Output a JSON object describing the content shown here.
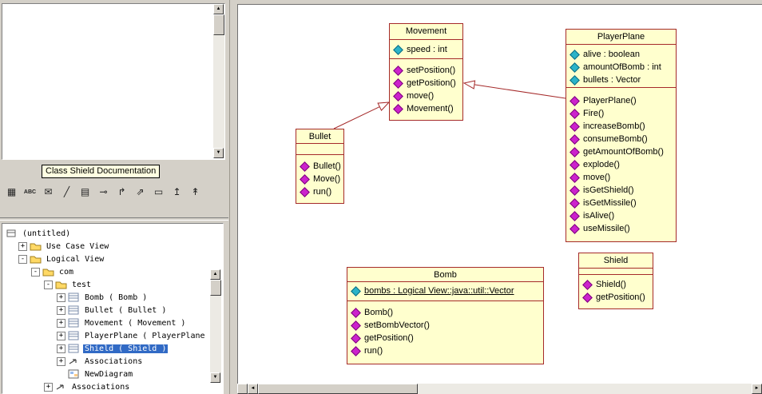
{
  "colors": {
    "chrome_bg": "#D4D0C8",
    "canvas_bg": "#FFFFFF",
    "class_fill": "#FFFFCE",
    "class_border": "#A52A2A",
    "selection": "#316AC5",
    "selection_text": "#FFFFFF",
    "tooltip_bg": "#FFFFE1",
    "attr_icon_color": "#2BB3C8",
    "method_icon_color": "#CC22CC"
  },
  "icons": {
    "up": "▲",
    "down": "▼",
    "left": "◄",
    "right": "►"
  },
  "tooltip": {
    "text": "Class Shield Documentation"
  },
  "toolbar": {
    "icons": [
      {
        "name": "grid-icon",
        "glyph": "▦"
      },
      {
        "name": "spellcheck-icon",
        "glyph": "ABC"
      },
      {
        "name": "note-icon",
        "glyph": "✉"
      },
      {
        "name": "pencil-icon",
        "glyph": "╱"
      },
      {
        "name": "document-icon",
        "glyph": "▤"
      },
      {
        "name": "anchor-note-icon",
        "glyph": "⊸"
      },
      {
        "name": "corner-arrow-icon",
        "glyph": "↱"
      },
      {
        "name": "diagonal-arrow-icon",
        "glyph": "⇗"
      },
      {
        "name": "container-icon",
        "glyph": "▭"
      },
      {
        "name": "up-arrow-icon",
        "glyph": "↥"
      },
      {
        "name": "promote-arrow-icon",
        "glyph": "↟"
      }
    ]
  },
  "tree": {
    "items": [
      {
        "label": "(untitled)",
        "icon": "model-icon",
        "level": 0
      },
      {
        "label": "Use Case View",
        "icon": "folder-icon",
        "level": 1,
        "expander": "plus"
      },
      {
        "label": "Logical View",
        "icon": "folder-icon",
        "level": 1,
        "expander": "minus"
      },
      {
        "label": "com",
        "icon": "folder-icon",
        "level": 2,
        "expander": "minus"
      },
      {
        "label": "test",
        "icon": "folder-icon",
        "level": 3,
        "expander": "minus"
      },
      {
        "label": "Bomb ( Bomb )",
        "icon": "class-icon",
        "level": 4,
        "expander": "plus"
      },
      {
        "label": "Bullet ( Bullet )",
        "icon": "class-icon",
        "level": 4,
        "expander": "plus"
      },
      {
        "label": "Movement ( Movement )",
        "icon": "class-icon",
        "level": 4,
        "expander": "plus"
      },
      {
        "label": "PlayerPlane ( PlayerPlane )",
        "icon": "class-icon",
        "level": 4,
        "expander": "plus"
      },
      {
        "label": "Shield ( Shield )",
        "icon": "class-icon",
        "level": 4,
        "expander": "plus",
        "selected": true
      },
      {
        "label": "Associations",
        "icon": "association-icon",
        "level": 4,
        "expander": "plus"
      },
      {
        "label": "NewDiagram",
        "icon": "diagram-icon",
        "level": 4
      },
      {
        "label": "Associations",
        "icon": "association-icon",
        "level": 3,
        "expander": "plus"
      }
    ]
  },
  "diagram": {
    "classes": {
      "movement": {
        "title": "Movement",
        "attributes": [
          "speed : int"
        ],
        "methods": [
          "setPosition()",
          "getPosition()",
          "move()",
          "Movement()"
        ]
      },
      "playerplane": {
        "title": "PlayerPlane",
        "attributes": [
          "alive : boolean",
          "amountOfBomb : int",
          "bullets : Vector"
        ],
        "methods": [
          "PlayerPlane()",
          "Fire()",
          "increaseBomb()",
          "consumeBomb()",
          "getAmountOfBomb()",
          "explode()",
          "move()",
          "isGetShield()",
          "isGetMissile()",
          "isAlive()",
          "useMissile()"
        ]
      },
      "bullet": {
        "title": "Bullet",
        "attributes": [],
        "methods": [
          "Bullet()",
          "Move()",
          "run()"
        ]
      },
      "bomb": {
        "title": "Bomb",
        "attributes": [
          "bombs : Logical View::java::util::Vector"
        ],
        "static_attribute": true,
        "methods": [
          "Bomb()",
          "setBombVector()",
          "getPosition()",
          "run()"
        ]
      },
      "shield": {
        "title": "Shield",
        "attributes": [],
        "methods": [
          "Shield()",
          "getPosition()"
        ]
      }
    },
    "relations": [
      {
        "type": "generalization",
        "from": "Bullet",
        "to": "Movement"
      },
      {
        "type": "generalization",
        "from": "PlayerPlane",
        "to": "Movement"
      }
    ]
  }
}
